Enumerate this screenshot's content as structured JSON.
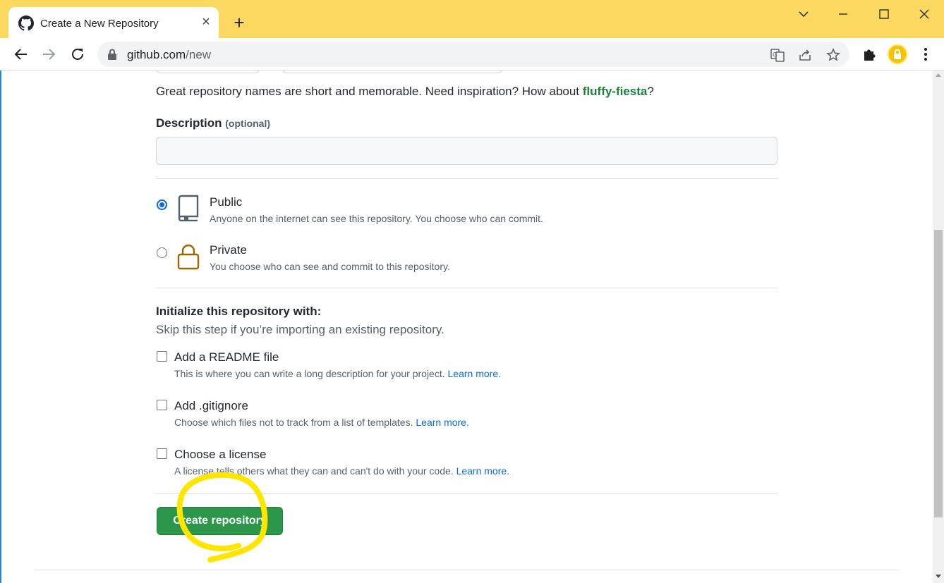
{
  "browser": {
    "tab_title": "Create a New Repository",
    "url_domain": "github.com",
    "url_path": "/new"
  },
  "form": {
    "name_hint_prefix": "Great repository names are short and memorable. Need inspiration? How about ",
    "name_suggestion": "fluffy-fiesta",
    "name_hint_suffix": "?",
    "description_label": "Description",
    "description_optional": "(optional)",
    "description_value": "",
    "visibility": [
      {
        "title": "Public",
        "desc": "Anyone on the internet can see this repository. You choose who can commit.",
        "selected": true,
        "icon": "repo-icon"
      },
      {
        "title": "Private",
        "desc": "You choose who can see and commit to this repository.",
        "selected": false,
        "icon": "lock-icon"
      }
    ],
    "init_title": "Initialize this repository with:",
    "init_subtitle": "Skip this step if you’re importing an existing repository.",
    "init_options": [
      {
        "title": "Add a README file",
        "desc": "This is where you can write a long description for your project. ",
        "link": "Learn more.",
        "checked": false
      },
      {
        "title": "Add .gitignore",
        "desc": "Choose which files not to track from a list of templates. ",
        "link": "Learn more.",
        "checked": false
      },
      {
        "title": "Choose a license",
        "desc": "A license tells others what they can and can't do with your code. ",
        "link": "Learn more.",
        "checked": false
      }
    ],
    "submit_label": "Create repository"
  },
  "colors": {
    "tabstrip": "#fbd960",
    "primary_button": "#2c974b",
    "link": "#0969da",
    "suggestion": "#1a7f37",
    "annotation": "#ffe600"
  }
}
